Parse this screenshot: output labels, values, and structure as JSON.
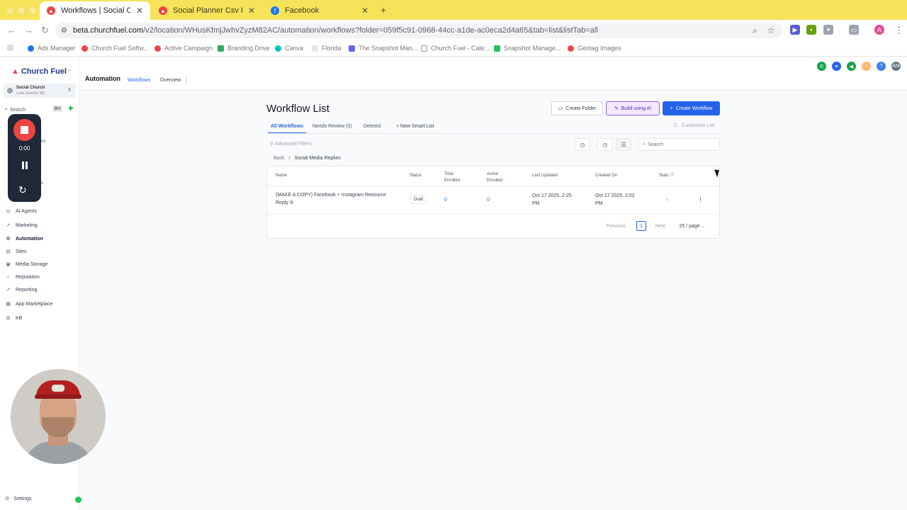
{
  "browser": {
    "tabs": [
      {
        "label": "Workflows | Social Church",
        "active": true
      },
      {
        "label": "Social Planner Csv Edit | And",
        "active": false
      },
      {
        "label": "Facebook",
        "active": false
      }
    ],
    "url_host": "beta.churchfuel.com",
    "url_path": "/v2/location/WHusKfmjJwhvZyzM82AC/automation/workflows?folder=059f5c91-0968-44cc-a1de-ac0eca2d4a65&tab=list&listTab=all",
    "bookmarks": [
      "Ads Manager",
      "Church Fuel Softw...",
      "Active Campaign",
      "Branding Drive",
      "Canva",
      "Florida",
      "The Snapshot Man...",
      "Church Fuel - Cale...",
      "Snapshot Manage...",
      "Geotag Images"
    ]
  },
  "sidebar": {
    "brand": "Church Fuel",
    "account_name": "Social Church",
    "account_location": "Lexis Summit, MD",
    "search_label": "Search",
    "search_shortcut": "⌘K",
    "partial_labels": [
      "ns",
      "s"
    ],
    "items": [
      {
        "label": "AI Agents",
        "icon": "ai-agents-icon"
      },
      {
        "label": "Marketing",
        "icon": "marketing-icon"
      },
      {
        "label": "Automation",
        "icon": "automation-icon",
        "active": true
      },
      {
        "label": "Sites",
        "icon": "sites-icon"
      },
      {
        "label": "Media Storage",
        "icon": "media-icon"
      },
      {
        "label": "Reputation",
        "icon": "star-icon"
      },
      {
        "label": "Reporting",
        "icon": "reporting-icon"
      },
      {
        "label": "App Marketplace",
        "icon": "marketplace-icon"
      },
      {
        "label": "KB",
        "icon": "kb-icon"
      }
    ],
    "settings_label": "Settings"
  },
  "recorder": {
    "time": "0:00"
  },
  "header": {
    "title": "Automation",
    "tabs": [
      {
        "label": "Workflows",
        "selected": true
      },
      {
        "label": "Overview",
        "selected": false
      }
    ]
  },
  "main": {
    "heading": "Workflow List",
    "btn_folder": "Create Folder",
    "btn_ai": "Build using AI",
    "btn_create": "Create Workflow",
    "tabs": [
      {
        "label": "All Workflows",
        "selected": true
      },
      {
        "label": "Needs Review (0)",
        "selected": false
      },
      {
        "label": "Deleted",
        "selected": false
      }
    ],
    "new_smart_list": "New Smart List",
    "customize_list": "Customize List",
    "advanced_filters": "Advanced Filters",
    "search_placeholder": "Search",
    "breadcrumb": {
      "back": "Back",
      "sep": "/",
      "current": "Social Media Replies"
    },
    "columns": [
      "Name",
      "Status",
      "Total Enrolled",
      "Active Enrolled",
      "Last Updated",
      "Created On",
      "Stats"
    ],
    "rows": [
      {
        "name_line1": "(MAKE A COPY) Facebook + Instagram Resource",
        "name_line2": "Reply",
        "status": "Draft",
        "total_enrolled": "0",
        "active_enrolled": "0",
        "last_updated_1": "Oct 17 2025, 2:25",
        "last_updated_2": "PM",
        "created_on_1": "Oct 17 2025, 2:02",
        "created_on_2": "PM"
      }
    ],
    "pagination": {
      "previous": "Previous",
      "page": "1",
      "next": "Next",
      "per_page": "25 / page"
    }
  }
}
